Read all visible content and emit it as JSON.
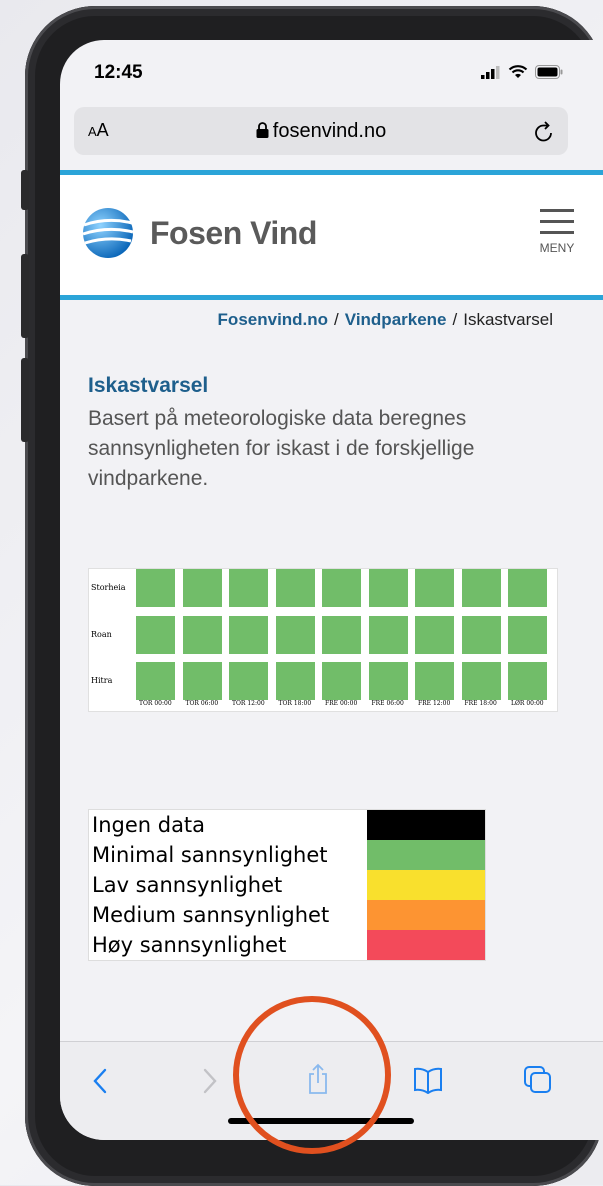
{
  "status": {
    "time": "12:45"
  },
  "browser": {
    "aa_small": "A",
    "aa_big": "A",
    "url": "fosenvind.no"
  },
  "site": {
    "brand": "Fosen Vind",
    "menu_label": "MENY"
  },
  "breadcrumb": {
    "home": "Fosenvind.no",
    "parent": "Vindparkene",
    "current": "Iskastvarsel",
    "separator": "/"
  },
  "article": {
    "title": "Iskastvarsel",
    "intro": "Basert på meteorologiske data beregnes sannsynligheten for iskast i de forskjellige vindparkene."
  },
  "forecast_grid": {
    "rows": [
      "Storheia",
      "Roan",
      "Hitra"
    ],
    "columns": [
      "TOR 00:00",
      "TOR 06:00",
      "TOR 12:00",
      "TOR 18:00",
      "FRE 00:00",
      "FRE 06:00",
      "FRE 12:00",
      "FRE 18:00",
      "LØR 00:00"
    ],
    "level": "Minimal sannsynlighet",
    "cell_color": "#71bd69"
  },
  "legend": [
    {
      "label": "Ingen data",
      "color": "#000000"
    },
    {
      "label": "Minimal sannsynlighet",
      "color": "#71bd69"
    },
    {
      "label": "Lav sannsynlighet",
      "color": "#f9e02d"
    },
    {
      "label": "Medium sannsynlighet",
      "color": "#fd9432"
    },
    {
      "label": "Høy sannsynlighet",
      "color": "#f34a5a"
    }
  ],
  "toolbar": {
    "icons": [
      "back-icon",
      "forward-icon",
      "share-icon",
      "bookmarks-icon",
      "tabs-icon"
    ],
    "accent": "#1a7ff0"
  },
  "highlight_color": "#e0501f"
}
